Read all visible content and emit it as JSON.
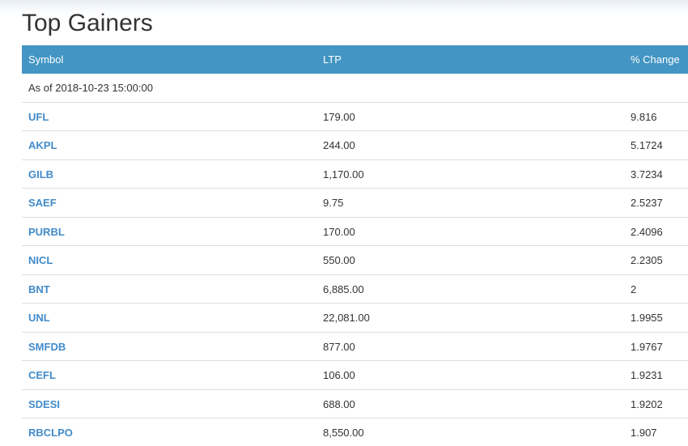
{
  "title": "Top Gainers",
  "table": {
    "headers": {
      "symbol": "Symbol",
      "ltp": "LTP",
      "change": "% Change"
    },
    "as_of": "As of 2018-10-23 15:00:00",
    "rows": [
      {
        "symbol": "UFL",
        "ltp": "179.00",
        "change": "9.816"
      },
      {
        "symbol": "AKPL",
        "ltp": "244.00",
        "change": "5.1724"
      },
      {
        "symbol": "GILB",
        "ltp": "1,170.00",
        "change": "3.7234"
      },
      {
        "symbol": "SAEF",
        "ltp": "9.75",
        "change": "2.5237"
      },
      {
        "symbol": "PURBL",
        "ltp": "170.00",
        "change": "2.4096"
      },
      {
        "symbol": "NICL",
        "ltp": "550.00",
        "change": "2.2305"
      },
      {
        "symbol": "BNT",
        "ltp": "6,885.00",
        "change": "2"
      },
      {
        "symbol": "UNL",
        "ltp": "22,081.00",
        "change": "1.9955"
      },
      {
        "symbol": "SMFDB",
        "ltp": "877.00",
        "change": "1.9767"
      },
      {
        "symbol": "CEFL",
        "ltp": "106.00",
        "change": "1.9231"
      },
      {
        "symbol": "SDESI",
        "ltp": "688.00",
        "change": "1.9202"
      },
      {
        "symbol": "RBCLPO",
        "ltp": "8,550.00",
        "change": "1.907"
      }
    ]
  },
  "colors": {
    "header_bg": "#4395c3",
    "link": "#428bca"
  }
}
